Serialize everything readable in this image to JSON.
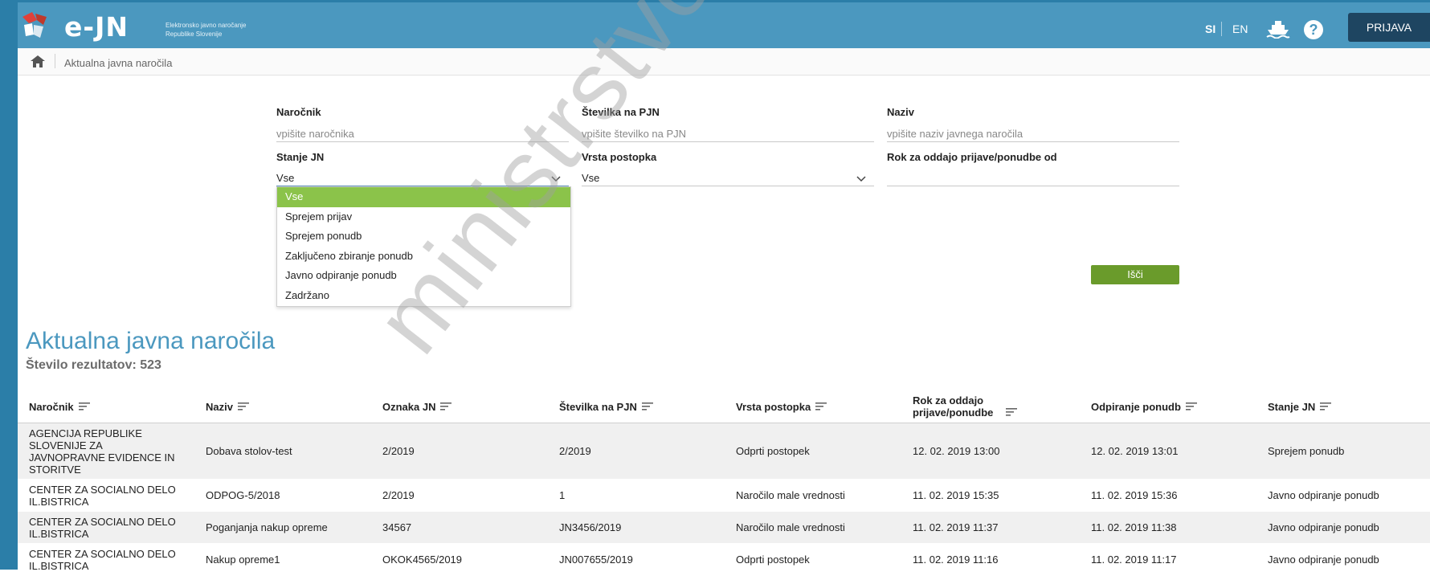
{
  "header": {
    "logo_text": "e-JN",
    "logo_sub_1": "Elektronsko javno naročanje",
    "logo_sub_2": "Republike Slovenije",
    "lang_si": "SI",
    "lang_en": "EN",
    "help": "?",
    "login_label": "PRIJAVA"
  },
  "breadcrumb": {
    "current": "Aktualna javna naročila"
  },
  "filters": {
    "narocnik": {
      "label": "Naročnik",
      "placeholder": "vpišite naročnika"
    },
    "stevilka": {
      "label": "Številka na PJN",
      "placeholder": "vpišite številko na PJN"
    },
    "naziv": {
      "label": "Naziv",
      "placeholder": "vpišite naziv javnega naročila"
    },
    "stanje": {
      "label": "Stanje JN",
      "value": "Vse"
    },
    "vrsta": {
      "label": "Vrsta postopka",
      "value": "Vse"
    },
    "rok": {
      "label": "Rok za oddajo prijave/ponudbe od"
    },
    "search_label": "Išči"
  },
  "dropdown": {
    "options": [
      "Vse",
      "Sprejem prijav",
      "Sprejem ponudb",
      "Zaključeno zbiranje ponudb",
      "Javno odpiranje ponudb",
      "Zadržano"
    ]
  },
  "results": {
    "title": "Aktualna javna naročila",
    "count": "Število rezultatov: 523"
  },
  "table": {
    "headers": [
      "Naročnik",
      "Naziv",
      "Oznaka JN",
      "Številka na PJN",
      "Vrsta postopka",
      "Rok za oddajo prijave/ponudbe",
      "Odpiranje ponudb",
      "Stanje JN"
    ],
    "rows": [
      [
        "AGENCIJA REPUBLIKE SLOVENIJE ZA JAVNOPRAVNE EVIDENCE IN STORITVE",
        "Dobava stolov-test",
        "2/2019",
        "2/2019",
        "Odprti postopek",
        "12. 02. 2019 13:00",
        "12. 02. 2019 13:01",
        "Sprejem ponudb"
      ],
      [
        "CENTER ZA SOCIALNO DELO IL.BISTRICA",
        "ODPOG-5/2018",
        "2/2019",
        "1",
        "Naročilo male vrednosti",
        "11. 02. 2019 15:35",
        "11. 02. 2019 15:36",
        "Javno odpiranje ponudb"
      ],
      [
        "CENTER ZA SOCIALNO DELO IL.BISTRICA",
        "Poganjanja nakup opreme",
        "34567",
        "JN3456/2019",
        "Naročilo male vrednosti",
        "11. 02. 2019 11:37",
        "11. 02. 2019 11:38",
        "Javno odpiranje ponudb"
      ],
      [
        "CENTER ZA SOCIALNO DELO IL.BISTRICA",
        "Nakup opreme1",
        "OKOK4565/2019",
        "JN007655/2019",
        "Odprti postopek",
        "11. 02. 2019 11:16",
        "11. 02. 2019 11:17",
        "Javno odpiranje ponudb"
      ]
    ]
  },
  "watermark": "ministrstvo za javno upravo",
  "colors": {
    "header": "#4b98bf",
    "accent_green": "#8bc34a",
    "button_green": "#6a9b2b",
    "login_dark": "#1e4561"
  }
}
